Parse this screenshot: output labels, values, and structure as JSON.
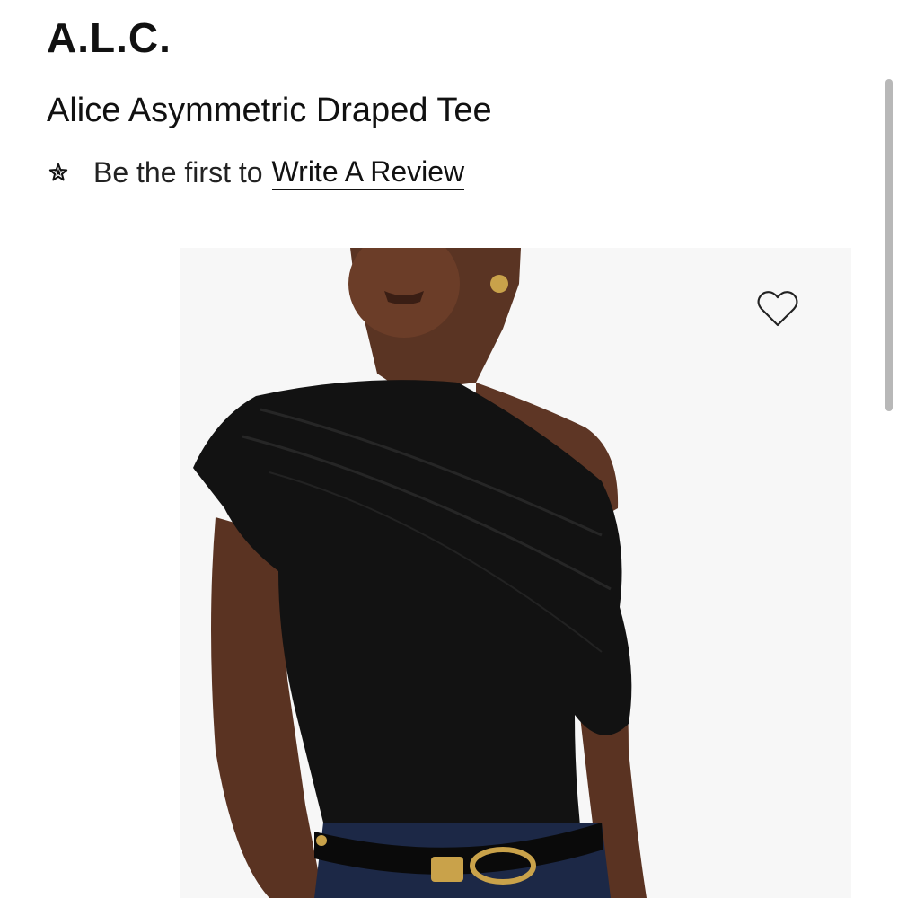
{
  "header": {
    "brand": "A.L.C."
  },
  "product": {
    "title": "Alice Asymmetric Draped Tee",
    "review": {
      "prefix": "Be the first to",
      "link_label": "Write A Review",
      "icon": "star-icon"
    },
    "image": {
      "description_icon": "product-photo",
      "background": "#f7f7f7"
    },
    "wishlist": {
      "icon": "heart-icon"
    }
  },
  "colors": {
    "text": "#111111",
    "scrollbar": "#b8b8b8"
  }
}
